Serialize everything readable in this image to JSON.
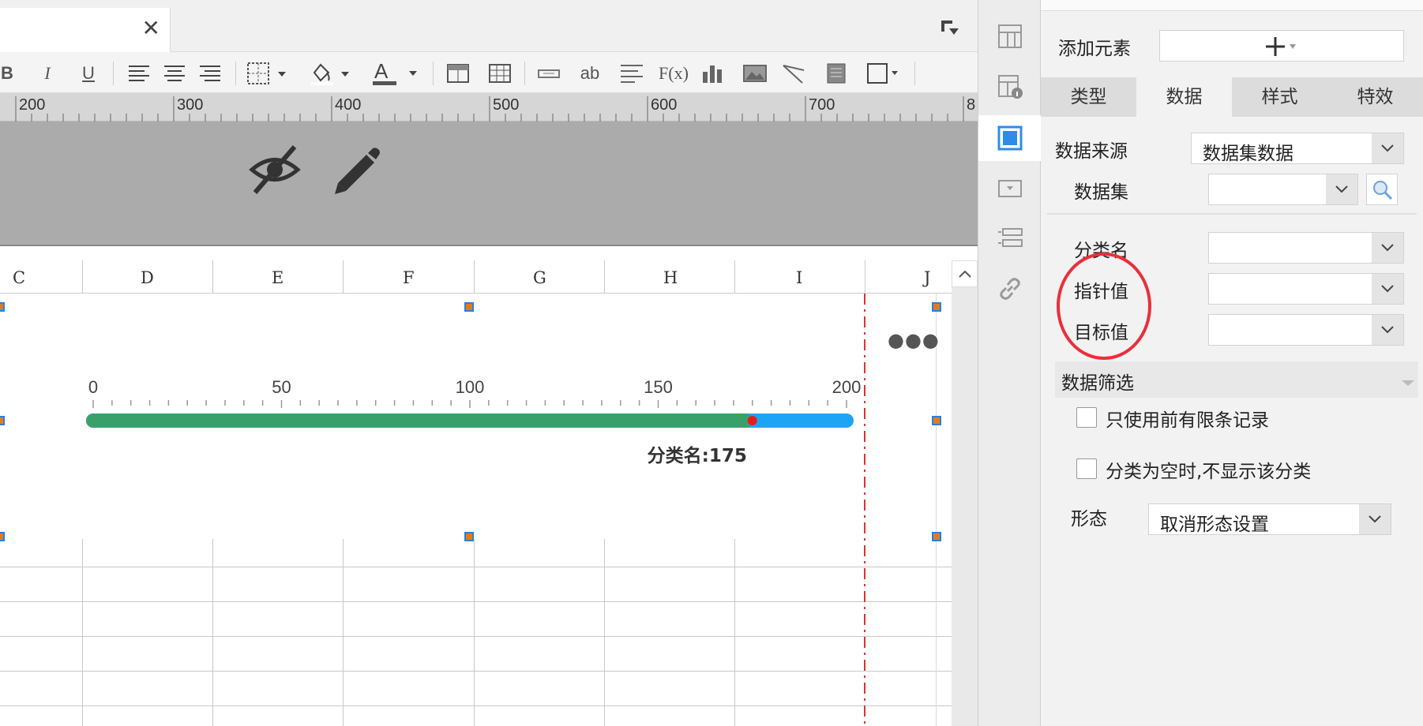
{
  "toolbar": {
    "bold": "B",
    "italic": "I",
    "underline": "U",
    "text_button": "ab",
    "formula_button": "F(x)"
  },
  "ruler": {
    "ticks": [
      "200",
      "300",
      "400",
      "500",
      "600",
      "700",
      "8"
    ]
  },
  "columns": [
    "C",
    "D",
    "E",
    "F",
    "G",
    "H",
    "I",
    "J"
  ],
  "gauge": {
    "axis_labels": [
      "0",
      "50",
      "100",
      "150",
      "200"
    ],
    "min": 0,
    "max": 200,
    "value": 175,
    "value_label": "分类名:175",
    "fill_color": "#3aa06a",
    "track_color": "#1ea4f5",
    "pointer_color": "#e51c1c"
  },
  "panel": {
    "add_element_label": "添加元素",
    "tabs": [
      "类型",
      "数据",
      "样式",
      "特效"
    ],
    "active_tab": "数据",
    "data_source_label": "数据来源",
    "data_source_value": "数据集数据",
    "dataset_label": "数据集",
    "dataset_value": "",
    "category_label": "分类名",
    "pointer_label": "指针值",
    "target_label": "目标值",
    "filter_section": "数据筛选",
    "limit_records_label": "只使用前有限条记录",
    "hide_empty_label": "分类为空时,不显示该分类",
    "state_label": "形态",
    "state_value": "取消形态设置",
    "highlight_color": "#e8303c"
  }
}
